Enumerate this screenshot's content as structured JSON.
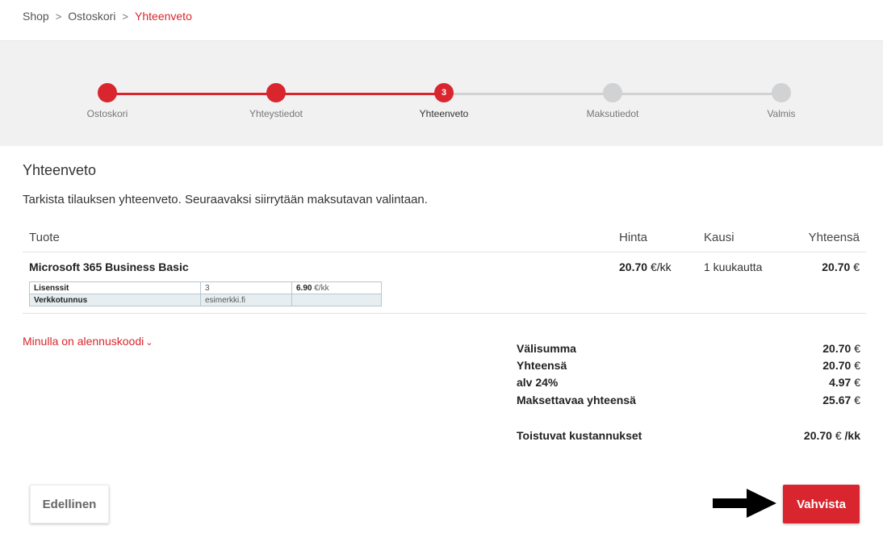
{
  "breadcrumb": {
    "items": [
      "Shop",
      "Ostoskori",
      "Yhteenveto"
    ]
  },
  "stepper": {
    "steps": [
      {
        "label": "Ostoskori",
        "state": "done"
      },
      {
        "label": "Yhteystiedot",
        "state": "done"
      },
      {
        "label": "Yhteenveto",
        "state": "active",
        "number": "3"
      },
      {
        "label": "Maksutiedot",
        "state": "todo"
      },
      {
        "label": "Valmis",
        "state": "todo"
      }
    ]
  },
  "summary_section": {
    "title": "Yhteenveto",
    "intro": "Tarkista tilauksen yhteenveto. Seuraavaksi siirrytään maksutavan valintaan."
  },
  "table": {
    "headers": {
      "product": "Tuote",
      "price": "Hinta",
      "period": "Kausi",
      "total": "Yhteensä"
    },
    "row": {
      "product": "Microsoft 365 Business Basic",
      "price_value": "20.70",
      "price_unit": "€/kk",
      "period": "1 kuukautta",
      "total_value": "20.70",
      "total_unit": "€",
      "details": [
        {
          "key": "Lisenssit",
          "value": "3",
          "extra_value": "6.90",
          "extra_unit": "€/kk"
        },
        {
          "key": "Verkkotunnus",
          "value": "esimerkki.fi",
          "extra_value": "",
          "extra_unit": ""
        }
      ]
    }
  },
  "discount": {
    "label": "Minulla on alennuskoodi",
    "chevron": "⌄"
  },
  "totals": {
    "subtotal_label": "Välisumma",
    "subtotal_value": "20.70",
    "subtotal_unit": "€",
    "total_label": "Yhteensä",
    "total_value": "20.70",
    "total_unit": "€",
    "vat_label": "alv 24%",
    "vat_value": "4.97",
    "vat_unit": "€",
    "payable_label": "Maksettavaa yhteensä",
    "payable_value": "25.67",
    "payable_unit": "€",
    "recurring_label": "Toistuvat kustannukset",
    "recurring_value": "20.70",
    "recurring_unit_a": "€",
    "recurring_unit_b": "/kk"
  },
  "buttons": {
    "previous": "Edellinen",
    "confirm": "Vahvista"
  },
  "colors": {
    "accent": "#d9262e",
    "inactive": "#d0d2d4",
    "stepper_bg": "#f1f1f1"
  },
  "icons": {
    "breadcrumb_separator": "chevron-right-icon",
    "discount_toggle": "chevron-down-icon",
    "pointer": "arrow-right-icon"
  }
}
